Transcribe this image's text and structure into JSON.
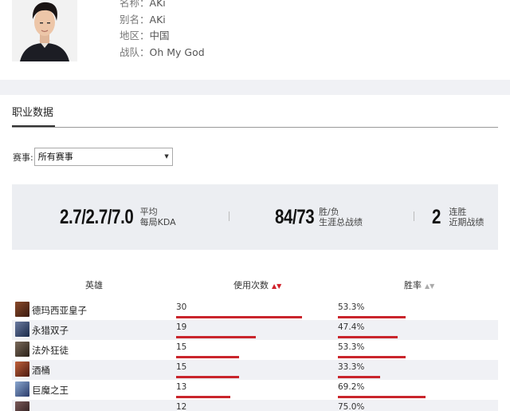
{
  "profile": {
    "fields": [
      {
        "label": "名称：",
        "value": "AKi"
      },
      {
        "label": "别名：",
        "value": "AKi"
      },
      {
        "label": "地区：",
        "value": "中国"
      },
      {
        "label": "战队：",
        "value": "Oh My God"
      }
    ]
  },
  "section": {
    "tab_label": "职业数据"
  },
  "filter": {
    "label": "赛事:",
    "selected": "所有赛事"
  },
  "stats": {
    "kda": {
      "value": "2.7/2.7/7.0",
      "line1": "平均",
      "line2": "每局KDA"
    },
    "record": {
      "value": "84/73",
      "line1": "胜/负",
      "line2": "生涯总战绩"
    },
    "streak": {
      "value": "2",
      "line1": "连胜",
      "line2": "近期战绩"
    }
  },
  "table": {
    "headers": {
      "hero": "英雄",
      "games": "使用次数",
      "winrate": "胜率"
    },
    "sort_state": {
      "games": "descending",
      "winrate": "unsorted"
    },
    "rows": [
      {
        "hero": "德玛西亚皇子",
        "games": "30",
        "winrate": "53.3%",
        "icon": "jarvan-portrait",
        "color": "#6a3a2a"
      },
      {
        "hero": "永猎双子",
        "games": "19",
        "winrate": "47.4%",
        "icon": "kindred-portrait",
        "color": "#3a4a6a"
      },
      {
        "hero": "法外狂徒",
        "games": "15",
        "winrate": "53.3%",
        "icon": "graves-portrait",
        "color": "#4a3a30"
      },
      {
        "hero": "酒桶",
        "games": "15",
        "winrate": "33.3%",
        "icon": "gragas-portrait",
        "color": "#7a3020"
      },
      {
        "hero": "巨魔之王",
        "games": "13",
        "winrate": "69.2%",
        "icon": "trundle-portrait",
        "color": "#3a5a7a"
      },
      {
        "hero": "",
        "games": "12",
        "winrate": "75.0%",
        "icon": "partial-portrait",
        "color": "#553a3a"
      }
    ]
  },
  "colors": {
    "accent": "#c9252c",
    "band": "#f0f1f5",
    "panel": "#eceef2"
  }
}
